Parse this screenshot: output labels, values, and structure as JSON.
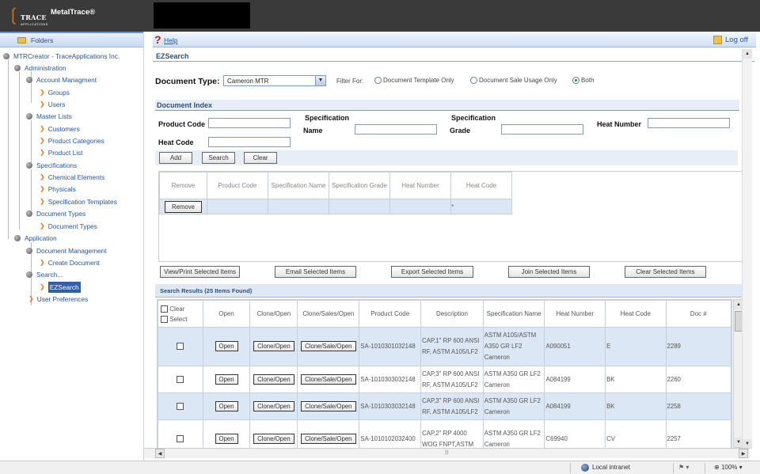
{
  "banner": {
    "brand_line1": "TRACE",
    "brand_line2": "APPLICATIONS",
    "product": "MetalTrace®"
  },
  "sidebar": {
    "folders_label": "Folders",
    "root": "MTRCreator - TraceApplications Inc.",
    "administration": "Administration",
    "account_management": "Account Managment",
    "groups": "Groups",
    "users": "Users",
    "master_lists": "Master Lists",
    "customers": "Customers",
    "product_categories": "Product Categories",
    "product_list": "Product List",
    "specifications": "Specifications",
    "chemical_elements": "Chemical Elements",
    "physicals": "Physicals",
    "specification_templates": "Specification Templates",
    "document_types": "Document Types",
    "document_types_child": "Document Types",
    "application": "Application",
    "document_management": "Document Management",
    "create_document": "Create Document",
    "search": "Search...",
    "ezsearch": "EZSearch",
    "user_preferences": "User Preferences"
  },
  "header": {
    "help": "Help",
    "logoff": "Log off"
  },
  "page": {
    "title": "EZSearch",
    "doc_type_label": "Document Type:",
    "doc_type_value": "Cameron MTR",
    "filter_label": "Filter For:",
    "filter_options": [
      "Document Template Only",
      "Document Sale Usage Only",
      "Both"
    ],
    "filter_selected": "Both"
  },
  "doc_index": {
    "title": "Document Index",
    "product_code_label": "Product Code",
    "spec_name_label_1": "Specification",
    "spec_name_label_2": "Name",
    "spec_grade_label_1": "Specification",
    "spec_grade_label_2": "Grade",
    "heat_number_label": "Heat Number",
    "heat_code_label": "Heat Code",
    "add": "Add",
    "search": "Search",
    "clear": "Clear",
    "columns": [
      "Remove",
      "Product Code",
      "Specification Name",
      "Specification Grade",
      "Heat Number",
      "Heat Code"
    ],
    "row": {
      "remove": "Remove",
      "heat_code": "*"
    }
  },
  "actions": {
    "view_print": "View/Print Selected Items",
    "email": "Email Selected Items",
    "export": "Export Selected Items",
    "join": "Join Selected Items",
    "clear": "Clear Selected Items"
  },
  "results": {
    "title": "Search Results  (25 Items Found)",
    "clear_label": "Clear",
    "select_label": "Select",
    "columns": [
      "Open",
      "Clone/Open",
      "Clone/Sales/Open",
      "Product Code",
      "Description",
      "Specification Name",
      "Heat Number",
      "Heat Code",
      "Doc #"
    ],
    "open_btn": "Open",
    "clone_btn": "Clone/Open",
    "clone_sale_btn": "Clone/Sale/Open",
    "rows": [
      {
        "product_code": "SA-1010301032148",
        "description": "CAP,1\" RP 600 ANSI RF, ASTM A105/LF2",
        "spec": "ASTM A105/ASTM A350 GR LF2 Cameron",
        "heat_number": "A090051",
        "heat_code": "E",
        "doc": "2289"
      },
      {
        "product_code": "SA-1010303032148",
        "description": "CAP,3\" RP 600 ANSI RF, ASTM A105/LF2",
        "spec": "ASTM A350 GR LF2 Cameron",
        "heat_number": "A084199",
        "heat_code": "BK",
        "doc": "2260"
      },
      {
        "product_code": "SA-1010303032148",
        "description": "CAP,3\" RP 600 ANSI RF, ASTM A105/LF2",
        "spec": "ASTM A350 GR LF2 Cameron",
        "heat_number": "A084199",
        "heat_code": "BK",
        "doc": "2258"
      },
      {
        "product_code": "SA-1010102032400",
        "description": "CAP,2\" RP 4000 WOG FNPT,ASTM",
        "spec": "ASTM A350 GR LF2 Cameron",
        "heat_number": "C69940",
        "heat_code": "CV",
        "doc": "2257"
      }
    ]
  },
  "statusbar": {
    "zone": "Local intranet",
    "zoom": "100%"
  }
}
